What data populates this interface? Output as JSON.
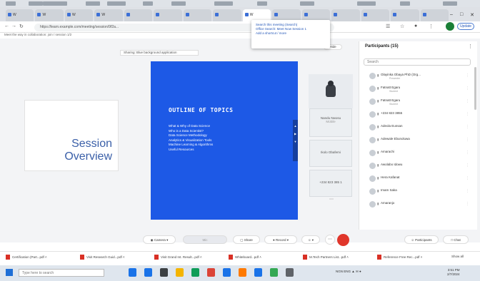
{
  "browser": {
    "tabs": [
      "W",
      "W",
      "W",
      "W",
      "",
      "",
      "",
      "",
      "W",
      "",
      "",
      "",
      "",
      "",
      ""
    ],
    "address": "https://learn.example.com/meeting/session/9f2a...",
    "update_label": "Update",
    "popup_lines": [
      "Search this meeting (Search)",
      "Office Search: Meet Now Session 1",
      "Add a shortcut / more"
    ]
  },
  "bookmarks_text": "Meet the way in collaboration: join / session 1/2",
  "banner_text": "Sharing: Blue background application",
  "hide_label": "Hide",
  "session_title": "Session Overview",
  "slide": {
    "title": "OUTLINE OF TOPICS",
    "items": [
      "What & Why of Data Science",
      "Who is a Data Scientist?",
      "Data Science Methodology",
      "Analytics & Visualization Tools",
      "Machine Learning & Algorithms",
      "Useful Resources"
    ]
  },
  "tiles": [
    {
      "name": "Nandu Nwosu",
      "sub": "Mobile"
    },
    {
      "name": "Ikolo Obafemi",
      "sub": ""
    },
    {
      "name": "+234 823 385 1",
      "sub": ""
    }
  ],
  "panel": {
    "title": "Participants (15)",
    "search_placeholder": "Search",
    "participants": [
      {
        "initials": "",
        "name": "Olayinka Obaya PhD (Org...",
        "sub": "Presenter"
      },
      {
        "initials": "",
        "name": "Fatnatt Egaru",
        "sub": "Student"
      },
      {
        "initials": "",
        "name": "Fatnatt Egaru",
        "sub": "Student"
      },
      {
        "initials": "",
        "name": "+234 823 3855",
        "sub": ""
      },
      {
        "initials": "",
        "name": "Adeola Eunsan",
        "sub": ""
      },
      {
        "initials": "",
        "name": "Adewale Ebunoluwa",
        "sub": ""
      },
      {
        "initials": "",
        "name": "Amarachi",
        "sub": ""
      },
      {
        "initials": "",
        "name": "Awolabo Idowu",
        "sub": ""
      },
      {
        "initials": "",
        "name": "Hera Kafanat",
        "sub": ""
      },
      {
        "initials": "",
        "name": "Imam Saka",
        "sub": ""
      },
      {
        "initials": "",
        "name": "Amaranjo",
        "sub": ""
      }
    ],
    "mute_all": "Mute all",
    "unmute_all": "Unmute all"
  },
  "controls": {
    "camera": "Camera",
    "mic": "Mic",
    "share": "Share",
    "record": "Record",
    "participants": "Participants",
    "chat": "Chat"
  },
  "downloads": [
    "Certification (Part...pdf",
    "Visit Research Guid...pdf",
    "Visit Grand Int. Result...pdf",
    "Whiteboard...pdf",
    "M.Tech Partners List...pdf",
    "Reference Free Rec...pdf"
  ],
  "show_all": "Show all",
  "taskbar": {
    "search_placeholder": "Type here to search",
    "tray": "NGN  ENG  ▲ ✉ ●",
    "time": "3:51 PM",
    "date": "2/7/2024"
  },
  "colors": {
    "slide_blue": "#1d59e6",
    "end_red": "#e0362b",
    "accent": "#3a5fa8"
  }
}
